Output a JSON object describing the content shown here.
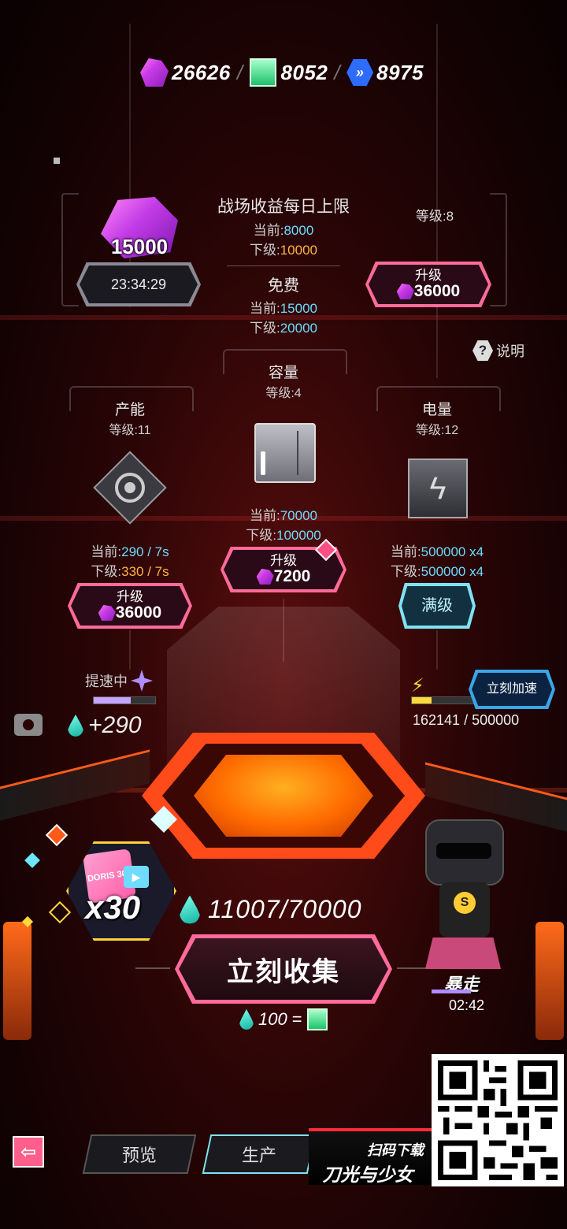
{
  "currencies": {
    "gem": "26626",
    "ticket": "8052",
    "chip": "8975"
  },
  "top_left": {
    "amount": "15000",
    "timer": "23:34:29"
  },
  "daily_limit": {
    "title": "战场收益每日上限",
    "current_prefix": "当前:",
    "current": "8000",
    "next_prefix": "下级:",
    "next": "10000",
    "free_label": "免费",
    "free_current_prefix": "当前:",
    "free_current": "15000",
    "free_next_prefix": "下级:",
    "free_next": "20000"
  },
  "top_right": {
    "level": "等级:8",
    "upgrade_label": "升级",
    "cost": "36000"
  },
  "help_label": "说明",
  "capacity": {
    "title": "容量",
    "level": "等级:4",
    "current_prefix": "当前:",
    "current": "70000",
    "next_prefix": "下级:",
    "next": "100000",
    "upgrade_label": "升级",
    "cost": "7200"
  },
  "production": {
    "title": "产能",
    "level": "等级:11",
    "current_prefix": "当前:",
    "current": "290 / 7s",
    "next_prefix": "下级:",
    "next": "330 / 7s",
    "upgrade_label": "升级",
    "cost": "36000"
  },
  "power": {
    "title": "电量",
    "level": "等级:12",
    "current_prefix": "当前:",
    "current": "500000 x4",
    "next_prefix": "下级:",
    "next": "500000 x4",
    "max_label": "满级"
  },
  "speedup": {
    "label": "提速中",
    "gain": "+290"
  },
  "boost": {
    "button_label": "立刻加速",
    "progress_text": "162141 / 500000",
    "progress_fraction": 0.324
  },
  "storage": {
    "text": "11007/70000",
    "multiplier": "x30",
    "badge_text": "DORIS 305"
  },
  "collect": {
    "button_label": "立刻收集",
    "rate_amount": "100",
    "rate_equals": "="
  },
  "character": {
    "status": "暴走",
    "timer": "02:42"
  },
  "tabs": {
    "preview": "预览",
    "production": "生产"
  },
  "promo": {
    "line1": "扫码下载",
    "line2": "刀光与少女"
  },
  "colors": {
    "accent_pink": "#ff6b9a",
    "accent_cyan": "#6fdcff",
    "accent_orange": "#ffb347",
    "teal_drop": "#13b39e"
  }
}
